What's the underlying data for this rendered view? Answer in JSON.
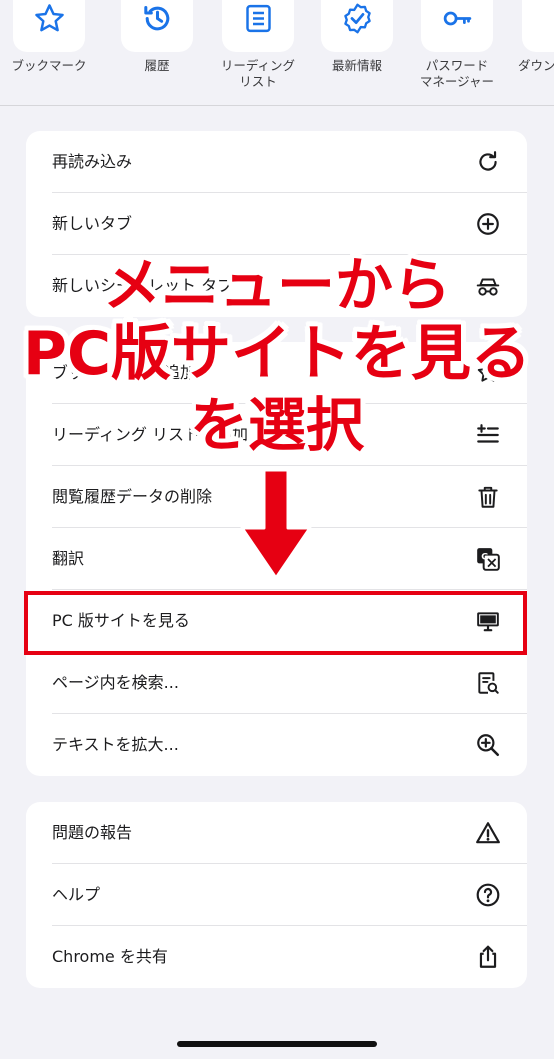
{
  "quick_actions": [
    {
      "label": "ブックマーク",
      "icon": "star-icon"
    },
    {
      "label": "履歴",
      "icon": "history-icon"
    },
    {
      "label": "リーディング\nリスト",
      "icon": "reading-list-icon"
    },
    {
      "label": "最新情報",
      "icon": "badge-check-icon"
    },
    {
      "label": "パスワード\nマネージャー",
      "icon": "key-icon"
    },
    {
      "label": "ダウン",
      "icon": "download-icon"
    }
  ],
  "menu_section_1": [
    {
      "label": "再読み込み",
      "icon": "reload-icon"
    },
    {
      "label": "新しいタブ",
      "icon": "plus-circle-icon"
    },
    {
      "label": "新しいシークレット タブ",
      "icon": "incognito-icon"
    }
  ],
  "menu_section_2": [
    {
      "label": "ブックマークを追加",
      "icon": "bookmark-star-icon"
    },
    {
      "label": "リーディング リストに追加",
      "icon": "add-list-icon"
    },
    {
      "label": "閲覧履歴データの削除",
      "icon": "trash-icon"
    },
    {
      "label": "翻訳",
      "icon": "translate-icon"
    },
    {
      "label": "PC 版サイトを見る",
      "icon": "desktop-icon"
    },
    {
      "label": "ページ内を検索...",
      "icon": "find-in-page-icon"
    },
    {
      "label": "テキストを拡大...",
      "icon": "zoom-in-icon"
    }
  ],
  "menu_section_3": [
    {
      "label": "問題の報告",
      "icon": "warning-icon"
    },
    {
      "label": "ヘルプ",
      "icon": "help-icon"
    },
    {
      "label": "Chrome を共有",
      "icon": "share-icon"
    }
  ],
  "annotation": {
    "line1": "メニューから",
    "line2": "PC版サイトを見る",
    "line3": "を選択",
    "color": "#e60012"
  },
  "accent_color": "#1a73e8"
}
